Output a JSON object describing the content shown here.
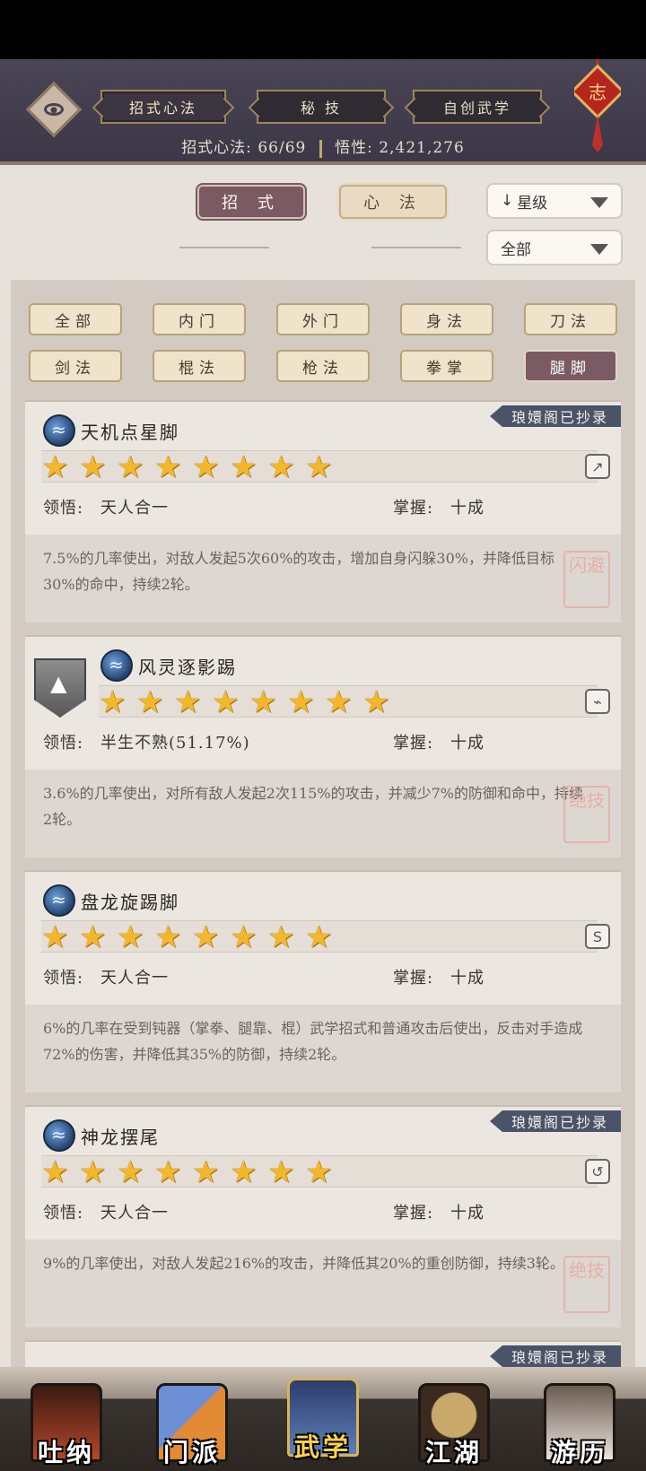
{
  "header": {
    "tabs": [
      "招式心法",
      "秘 技",
      "自创武学"
    ],
    "stats_label_1": "招式心法:",
    "stats_value_1": "66/69",
    "stats_label_2": "悟性:",
    "stats_value_2": "2,421,276",
    "knot_char": "志"
  },
  "primary_tabs": [
    "招 式",
    "心 法"
  ],
  "sort": {
    "arrow": "↓",
    "label": "星级"
  },
  "filter_dropdown": "全部",
  "categories": [
    "全部",
    "内门",
    "外门",
    "身法",
    "刀法",
    "剑法",
    "棍法",
    "枪法",
    "拳掌",
    "腿脚"
  ],
  "active_category": "腿脚",
  "cards": [
    {
      "title": "天机点星脚",
      "stars": 8,
      "ribbon": "琅嬛阁已抄录",
      "comprehension_label": "领悟:",
      "comprehension": "天人合一",
      "mastery_label": "掌握:",
      "mastery": "十成",
      "description": "7.5%的几率使出，对敌人发起5次60%的攻击，增加自身闪躲30%，并降低目标30%的命中，持续2轮。",
      "seal": "闪避"
    },
    {
      "title": "风灵逐影踢",
      "stars": 8,
      "ribbon": "",
      "comprehension_label": "领悟:",
      "comprehension": "半生不熟(51.17%)",
      "mastery_label": "掌握:",
      "mastery": "十成",
      "description": "3.6%的几率使出，对所有敌人发起2次115%的攻击，并减少7%的防御和命中，持续2轮。",
      "seal": "绝技"
    },
    {
      "title": "盘龙旋踢脚",
      "stars": 8,
      "ribbon": "",
      "comprehension_label": "领悟:",
      "comprehension": "天人合一",
      "mastery_label": "掌握:",
      "mastery": "十成",
      "description": "6%的几率在受到钝器（掌拳、腿靠、棍）武学招式和普通攻击后使出，反击对手造成72%的伤害，并降低其35%的防御，持续2轮。",
      "seal": ""
    },
    {
      "title": "神龙摆尾",
      "stars": 8,
      "ribbon": "琅嬛阁已抄录",
      "comprehension_label": "领悟:",
      "comprehension": "天人合一",
      "mastery_label": "掌握:",
      "mastery": "十成",
      "description": "9%的几率使出，对敌人发起216%的攻击，并降低其20%的重创防御，持续3轮。",
      "seal": "绝技"
    }
  ],
  "partial_ribbon": "琅嬛阁已抄录",
  "bottom_nav": [
    "吐纳",
    "门派",
    "武学",
    "江湖",
    "游历"
  ],
  "colors": {
    "header_bg": "#3b3747",
    "active_tab": "#7a5a63",
    "star": "#f3b72a",
    "ribbon": "#4a5468"
  }
}
